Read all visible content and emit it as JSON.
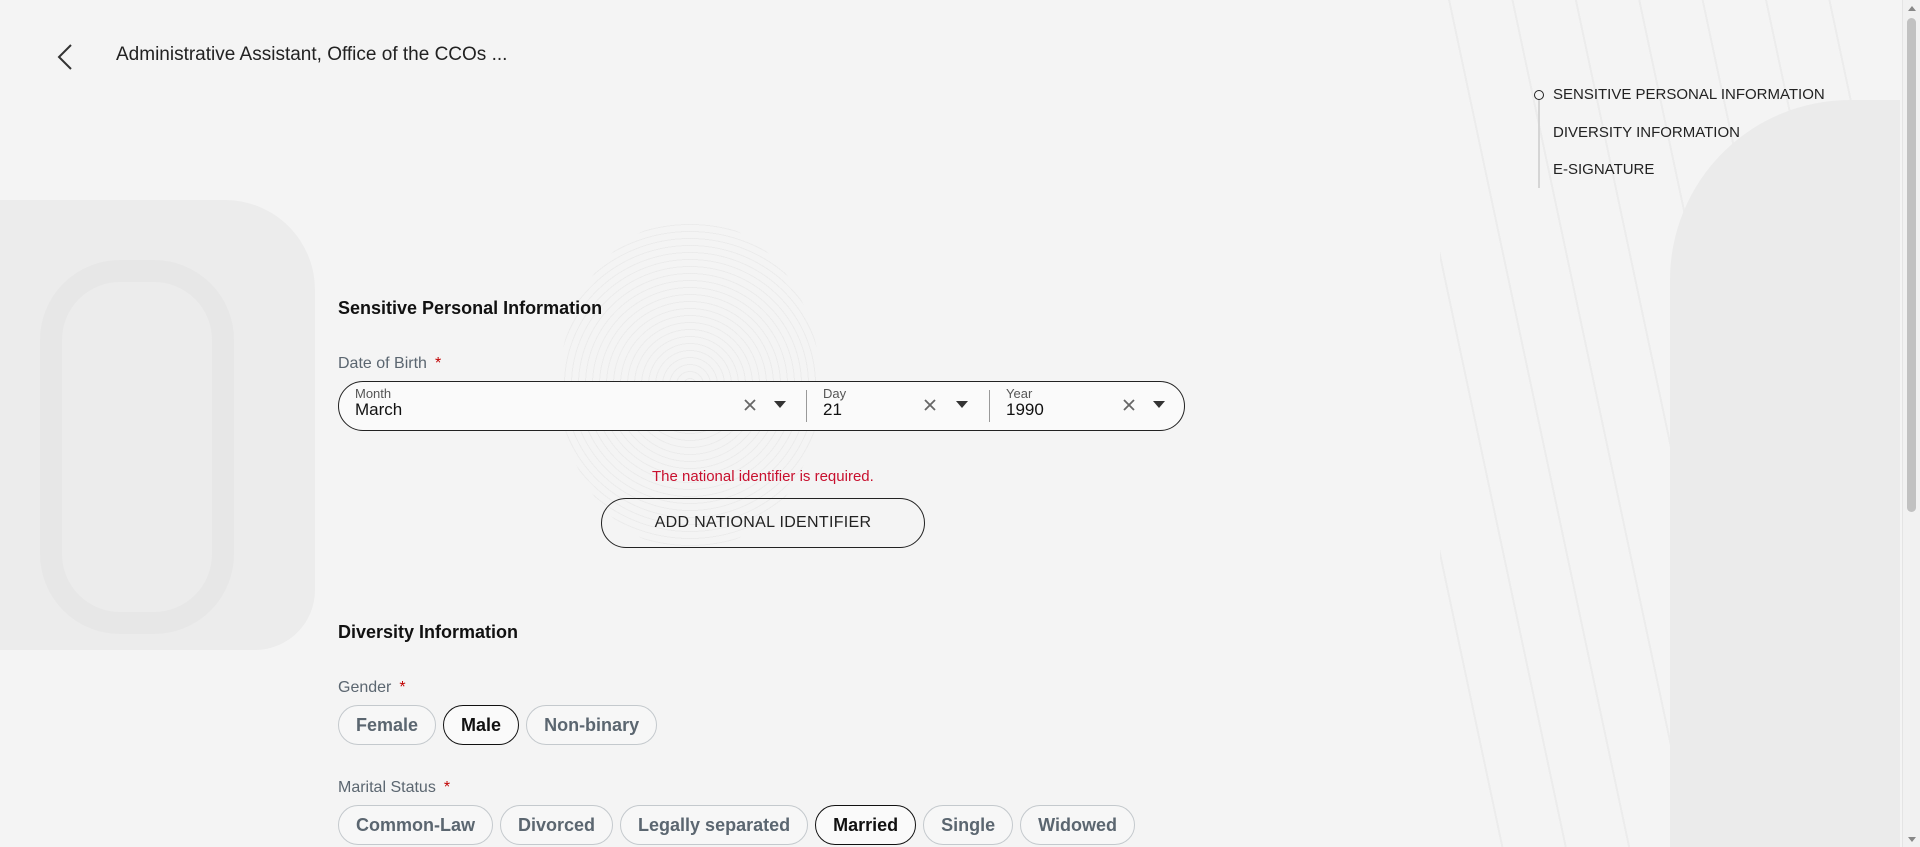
{
  "header": {
    "title": "Administrative Assistant, Office of the CCOs ...",
    "back_icon": "chevron-left-icon"
  },
  "anchor_nav": {
    "items": [
      {
        "label": "SENSITIVE PERSONAL INFORMATION",
        "active": true
      },
      {
        "label": "DIVERSITY INFORMATION",
        "active": false
      },
      {
        "label": "E-SIGNATURE",
        "active": false
      }
    ]
  },
  "sensitive_section": {
    "heading": "Sensitive Personal Information",
    "dob": {
      "label": "Date of Birth",
      "required_mark": "*",
      "month": {
        "label": "Month",
        "value": "March"
      },
      "day": {
        "label": "Day",
        "value": "21"
      },
      "year": {
        "label": "Year",
        "value": "1990"
      }
    },
    "national_id_error": "The national identifier is required.",
    "add_national_id_label": "ADD NATIONAL IDENTIFIER"
  },
  "diversity_section": {
    "heading": "Diversity Information",
    "gender": {
      "label": "Gender",
      "required_mark": "*",
      "options": [
        "Female",
        "Male",
        "Non-binary"
      ],
      "selected": "Male"
    },
    "marital_status": {
      "label": "Marital Status",
      "required_mark": "*",
      "options": [
        "Common-Law",
        "Divorced",
        "Legally separated",
        "Married",
        "Single",
        "Widowed"
      ],
      "selected": "Married"
    }
  },
  "colors": {
    "error": "#c8102e",
    "required": "#c00000",
    "label": "#5b6670",
    "border_selected": "#111111"
  }
}
